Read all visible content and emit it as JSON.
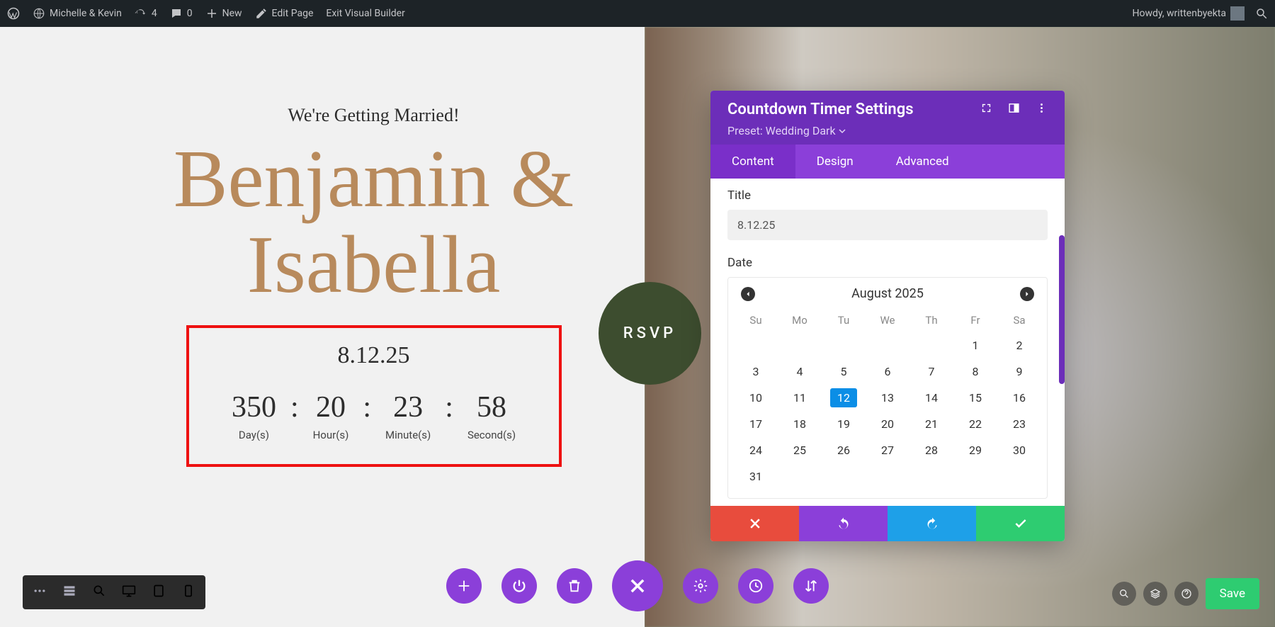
{
  "adminbar": {
    "site_name": "Michelle & Kevin",
    "updates": "4",
    "comments": "0",
    "new_label": "New",
    "edit_page": "Edit Page",
    "exit_builder": "Exit Visual Builder",
    "greeting": "Howdy, writtenbyekta"
  },
  "hero": {
    "tagline": "We're Getting Married!",
    "names": "Benjamin & Isabella",
    "rsvp": "RSVP"
  },
  "countdown": {
    "title": "8.12.25",
    "days_num": "350",
    "days_lbl": "Day(s)",
    "hours_num": "20",
    "hours_lbl": "Hour(s)",
    "minutes_num": "23",
    "minutes_lbl": "Minute(s)",
    "seconds_num": "58",
    "seconds_lbl": "Second(s)",
    "sep": ":"
  },
  "panel": {
    "title": "Countdown Timer Settings",
    "preset": "Preset: Wedding Dark",
    "tabs": {
      "content": "Content",
      "design": "Design",
      "advanced": "Advanced"
    },
    "title_field_label": "Title",
    "title_field_value": "8.12.25",
    "date_field_label": "Date",
    "calendar": {
      "month": "August 2025",
      "dow": [
        "Su",
        "Mo",
        "Tu",
        "We",
        "Th",
        "Fr",
        "Sa"
      ],
      "leading_blanks": 5,
      "days": 31,
      "selected": 12
    }
  },
  "save_label": "Save"
}
